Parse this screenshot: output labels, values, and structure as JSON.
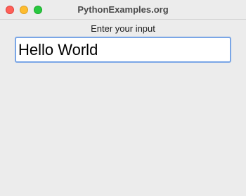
{
  "window": {
    "title": "PythonExamples.org",
    "buttons": {
      "close_color": "#ff5f57",
      "minimize_color": "#febc2e",
      "zoom_color": "#28c840"
    }
  },
  "form": {
    "prompt_label": "Enter your input",
    "input_value": "Hello World",
    "input_focus_color": "#7aa6e6"
  }
}
